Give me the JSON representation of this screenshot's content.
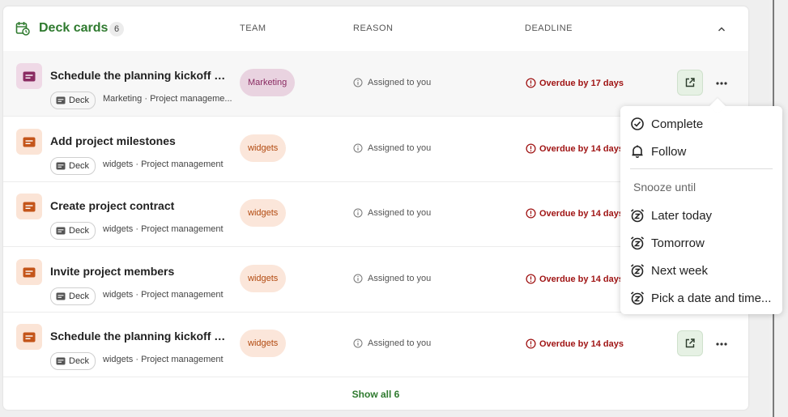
{
  "section": {
    "title": "Deck cards",
    "count": "6",
    "columns": {
      "team": "TEAM",
      "reason": "REASON",
      "deadline": "DEADLINE"
    }
  },
  "rows": [
    {
      "title": "Schedule the planning kickoff m...",
      "app": "Deck",
      "sub": "Marketing · Project manageme...",
      "team": "Marketing",
      "team_color": "#e9d3e0",
      "team_text": "#8a2b62",
      "icon_color": "#8a2b62",
      "icon_bg": "#efd9e6",
      "reason": "Assigned to you",
      "deadline": "Overdue by 17 days"
    },
    {
      "title": "Add project milestones",
      "app": "Deck",
      "sub": "widgets · Project management",
      "team": "widgets",
      "team_color": "#fbe6da",
      "team_text": "#b24a10",
      "icon_color": "#c4551a",
      "icon_bg": "#fbe4d6",
      "reason": "Assigned to you",
      "deadline": "Overdue by 14 days"
    },
    {
      "title": "Create project contract",
      "app": "Deck",
      "sub": "widgets · Project management",
      "team": "widgets",
      "team_color": "#fbe6da",
      "team_text": "#b24a10",
      "icon_color": "#c4551a",
      "icon_bg": "#fbe4d6",
      "reason": "Assigned to you",
      "deadline": "Overdue by 14 days"
    },
    {
      "title": "Invite project members",
      "app": "Deck",
      "sub": "widgets · Project management",
      "team": "widgets",
      "team_color": "#fbe6da",
      "team_text": "#b24a10",
      "icon_color": "#c4551a",
      "icon_bg": "#fbe4d6",
      "reason": "Assigned to you",
      "deadline": "Overdue by 14 days"
    },
    {
      "title": "Schedule the planning kickoff m...",
      "app": "Deck",
      "sub": "widgets · Project management",
      "team": "widgets",
      "team_color": "#fbe6da",
      "team_text": "#b24a10",
      "icon_color": "#c4551a",
      "icon_bg": "#fbe4d6",
      "reason": "Assigned to you",
      "deadline": "Overdue by 14 days"
    }
  ],
  "footer": {
    "show_all": "Show all 6"
  },
  "menu": {
    "complete": "Complete",
    "follow": "Follow",
    "snooze_heading": "Snooze until",
    "later_today": "Later today",
    "tomorrow": "Tomorrow",
    "next_week": "Next week",
    "pick_date": "Pick a date and time..."
  },
  "colors": {
    "accent": "#2f7a2f",
    "overdue": "#a01515"
  }
}
